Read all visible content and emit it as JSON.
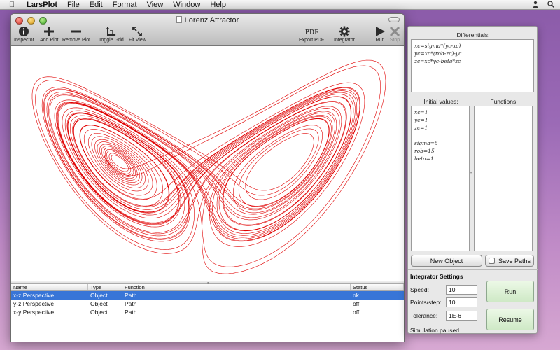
{
  "menubar": {
    "app_name": "LarsPlot",
    "menus": [
      "File",
      "Edit",
      "Format",
      "View",
      "Window",
      "Help"
    ]
  },
  "window": {
    "title": "Lorenz Attractor"
  },
  "toolbar": {
    "inspector": "Inspector",
    "add_plot": "Add Plot",
    "remove_plot": "Remove Plot",
    "toggle_grid": "Toggle Grid",
    "fit_view": "Fit View",
    "export_pdf": "Export PDF",
    "integrator": "Integrator",
    "run": "Run",
    "stop": "Stop"
  },
  "plot": {
    "trace_color": "#e00000",
    "projection": "x-z"
  },
  "table": {
    "headers": [
      "Name",
      "Type",
      "Function",
      "Status"
    ],
    "rows": [
      {
        "name": "x-z Perspective",
        "type": "Object",
        "function": "Path",
        "status": "ok",
        "selected": true
      },
      {
        "name": "y-z Perspective",
        "type": "Object",
        "function": "Path",
        "status": "off",
        "selected": false
      },
      {
        "name": "x-y Perspective",
        "type": "Object",
        "function": "Path",
        "status": "off",
        "selected": false
      }
    ]
  },
  "inspector": {
    "differentials_label": "Differentials:",
    "differentials": [
      "xc=sigma*(yc-xc)",
      "yc=xc*(rob-zc)-yc",
      "zc=xc*yc-beta*zc"
    ],
    "initial_values_label": "Initial values:",
    "initial_values": [
      "xc=1",
      "yc=1",
      "zc=1",
      "",
      "sigma=5",
      "rob=15",
      "beta=1"
    ],
    "functions_label": "Functions:",
    "new_object": "New Object",
    "save_paths": "Save Paths",
    "settings_title": "Integrator Settings",
    "speed_label": "Speed:",
    "speed": "10",
    "points_label": "Points/step:",
    "points": "10",
    "tolerance_label": "Tolerance:",
    "tolerance": "1E-6",
    "run": "Run",
    "resume": "Resume",
    "status": "Simulation paused"
  },
  "colors": {
    "selection": "#3875d7",
    "trace": "#e00000"
  }
}
